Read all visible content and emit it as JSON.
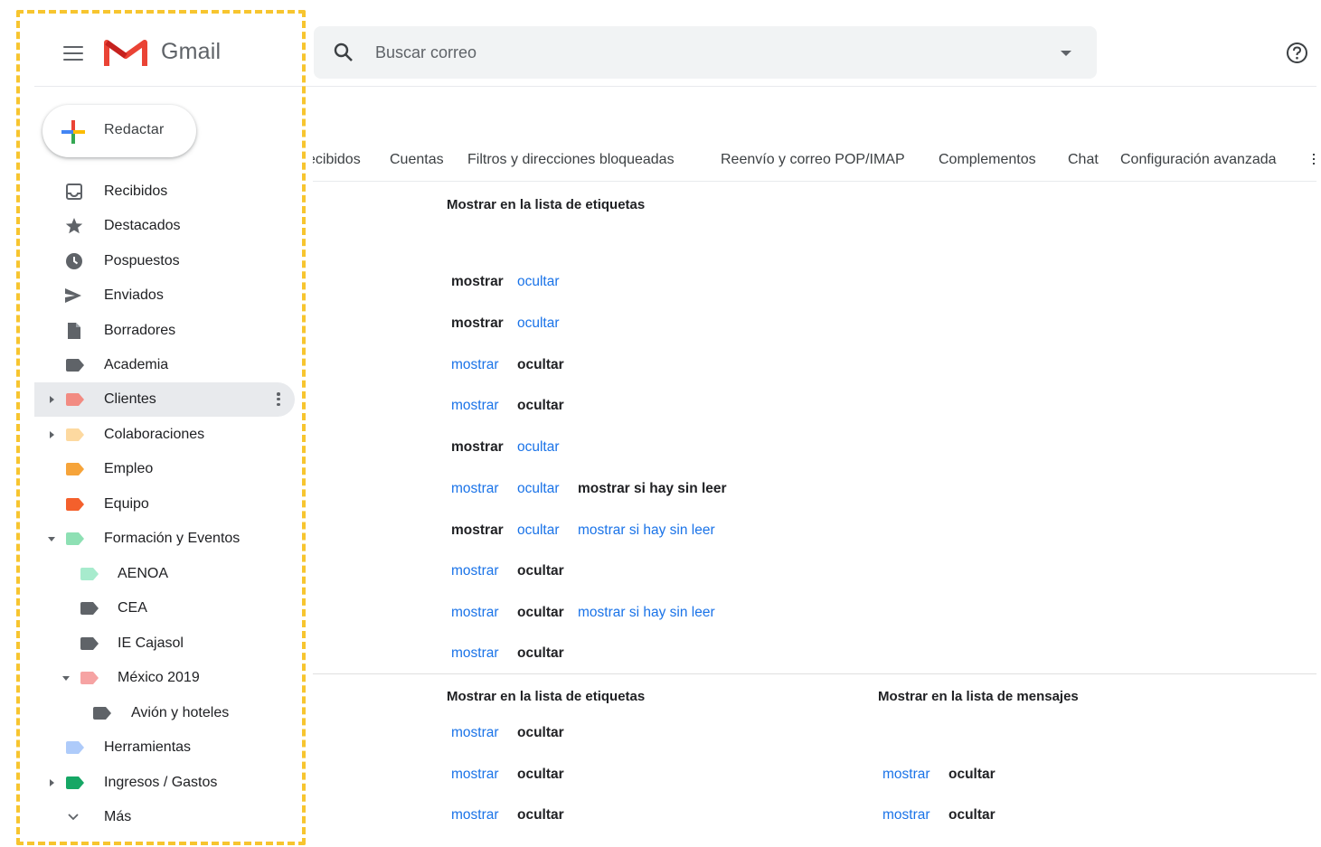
{
  "app": {
    "name": "Gmail"
  },
  "compose": {
    "label": "Redactar"
  },
  "sidebar": {
    "items": [
      {
        "label": "Recibidos",
        "icon": "inbox-icon"
      },
      {
        "label": "Destacados",
        "icon": "star-icon"
      },
      {
        "label": "Pospuestos",
        "icon": "clock-icon"
      },
      {
        "label": "Enviados",
        "icon": "send-icon"
      },
      {
        "label": "Borradores",
        "icon": "draft-icon"
      },
      {
        "label": "Academia",
        "color": "#5f6368"
      },
      {
        "label": "Clientes",
        "color": "#f28b82"
      },
      {
        "label": "Colaboraciones",
        "color": "#fdd9a0"
      },
      {
        "label": "Empleo",
        "color": "#f6a43a"
      },
      {
        "label": "Equipo",
        "color": "#f4602c"
      },
      {
        "label": "Formación y Eventos",
        "color": "#8ee0b4"
      },
      {
        "label": "AENOA",
        "color": "#a7ebcd"
      },
      {
        "label": "CEA",
        "color": "#5f6368"
      },
      {
        "label": "IE Cajasol",
        "color": "#5f6368"
      },
      {
        "label": "México 2019",
        "color": "#f6a3a3"
      },
      {
        "label": "Avión y hoteles",
        "color": "#5f6368"
      },
      {
        "label": "Herramientas",
        "color": "#aecbfa"
      },
      {
        "label": "Ingresos / Gastos",
        "color": "#16a765"
      },
      {
        "label": "Más",
        "icon": "chevron-down-icon"
      }
    ]
  },
  "search": {
    "placeholder": "Buscar correo"
  },
  "tabs": [
    "ecibidos",
    "Cuentas",
    "Filtros y direcciones bloqueadas",
    "Reenvío y correo POP/IMAP",
    "Complementos",
    "Chat",
    "Configuración avanzada"
  ],
  "content": {
    "section1_heading": "Mostrar en la lista de etiquetas",
    "section2_heading_labels": "Mostrar en la lista de etiquetas",
    "section2_heading_messages": "Mostrar en la lista de mensajes",
    "options": {
      "show": "mostrar",
      "hide": "ocultar",
      "show_unread": "mostrar si hay sin leer"
    }
  },
  "colors": {
    "link": "#1a73e8",
    "highlight_border": "#f7c52f"
  }
}
